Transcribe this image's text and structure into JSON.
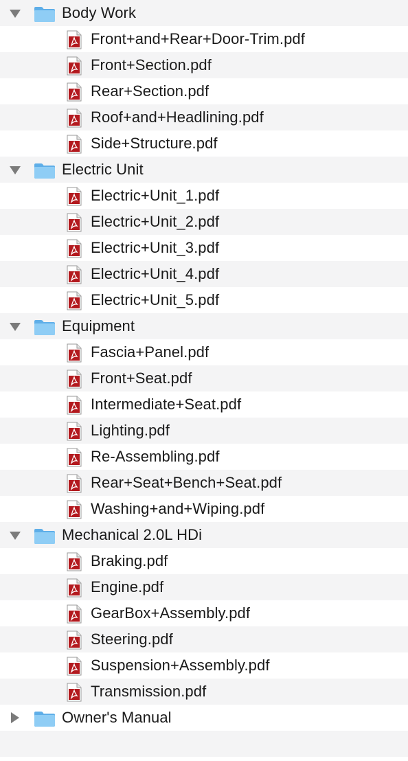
{
  "groups": [
    {
      "name": "Body Work",
      "expanded": true,
      "files": [
        "Front+and+Rear+Door-Trim.pdf",
        "Front+Section.pdf",
        "Rear+Section.pdf",
        "Roof+and+Headlining.pdf",
        "Side+Structure.pdf"
      ]
    },
    {
      "name": "Electric Unit",
      "expanded": true,
      "files": [
        "Electric+Unit_1.pdf",
        "Electric+Unit_2.pdf",
        "Electric+Unit_3.pdf",
        "Electric+Unit_4.pdf",
        "Electric+Unit_5.pdf"
      ]
    },
    {
      "name": "Equipment",
      "expanded": true,
      "files": [
        "Fascia+Panel.pdf",
        "Front+Seat.pdf",
        "Intermediate+Seat.pdf",
        "Lighting.pdf",
        "Re-Assembling.pdf",
        "Rear+Seat+Bench+Seat.pdf",
        "Washing+and+Wiping.pdf"
      ]
    },
    {
      "name": "Mechanical 2.0L HDi",
      "expanded": true,
      "files": [
        "Braking.pdf",
        "Engine.pdf",
        "GearBox+Assembly.pdf",
        "Steering.pdf",
        "Suspension+Assembly.pdf",
        "Transmission.pdf"
      ]
    },
    {
      "name": "Owner's Manual",
      "expanded": false,
      "files": []
    }
  ],
  "icons": {
    "folder": "folder-icon",
    "file": "pdf-file-icon",
    "expanded": "disclosure-triangle-down-icon",
    "collapsed": "disclosure-triangle-right-icon"
  },
  "colors": {
    "row_alt": "#f4f4f5",
    "folder_fill": "#7fc3f0",
    "pdf_red": "#b3191e",
    "triangle": "#7b7b7b"
  }
}
